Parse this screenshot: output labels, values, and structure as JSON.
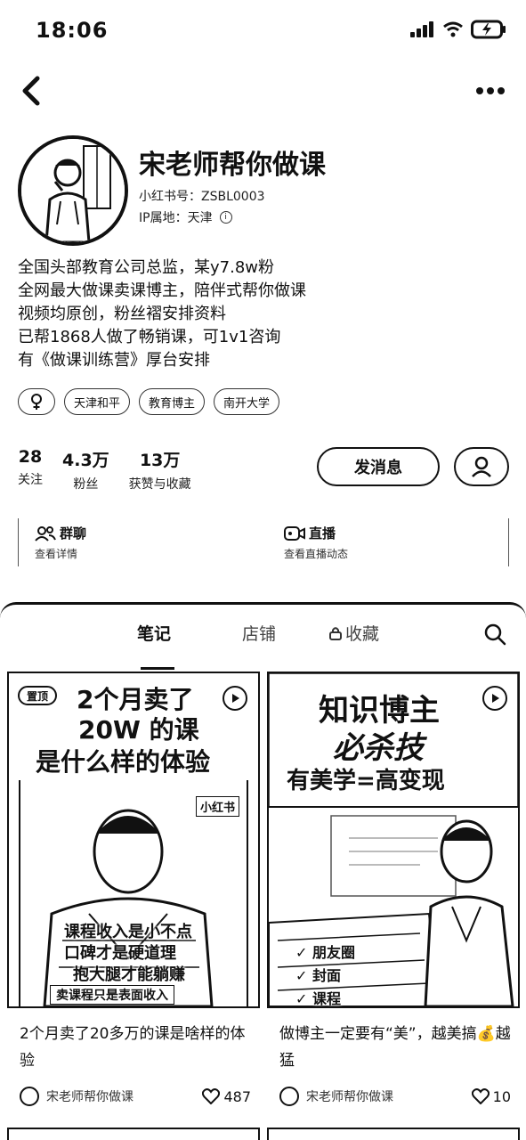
{
  "status": {
    "time": "18:06"
  },
  "profile": {
    "name": "宋老师帮你做课",
    "id_label": "小红书号：ZSBL0003",
    "ip_label": "IP属地：天津",
    "bio": [
      "全国头部教育公司总监，某y7.8w粉",
      "全网最大做课卖课博主，陪伴式帮你做课",
      "视频均原创，粉丝褶安排资料",
      "已帮1868人做了畅销课，可1v1咨询",
      "有《做课训练营》厚台安排"
    ],
    "tags": [
      "天津和平",
      "教育博主",
      "南开大学"
    ],
    "stats": [
      {
        "num": "28",
        "label": "关注"
      },
      {
        "num": "4.3万",
        "label": "粉丝"
      },
      {
        "num": "13万",
        "label": "获赞与收藏"
      }
    ],
    "message_button": "发消息"
  },
  "features": [
    {
      "title": "群聊",
      "sub": "查看详情",
      "icon": "group-chat-icon"
    },
    {
      "title": "直播",
      "sub": "查看直播动态",
      "icon": "live-icon"
    }
  ],
  "tabs": [
    "笔记",
    "店铺",
    "收藏"
  ],
  "notes": [
    {
      "badge": "置顶",
      "overlay_lines": [
        "2个月卖了",
        "20W 的课",
        "是什么样的体验"
      ],
      "watermark": "小红书",
      "bottom_lines": [
        "课程收入是小不点",
        "口碑才是硬道理",
        "抱大腿才能躺赚",
        "卖课程只是表面收入"
      ],
      "title": "2个月卖了20多万的课是啥样的体验",
      "author": "宋老师帮你做课",
      "likes": "487"
    },
    {
      "overlay_lines": [
        "知识博主",
        "必杀技",
        "有美学=高变现"
      ],
      "check_items": [
        "朋友圈",
        "封面",
        "课程"
      ],
      "title": "做博主一定要有“美”，越美搞💰越猛",
      "author": "宋老师帮你做课",
      "likes": "10"
    }
  ]
}
